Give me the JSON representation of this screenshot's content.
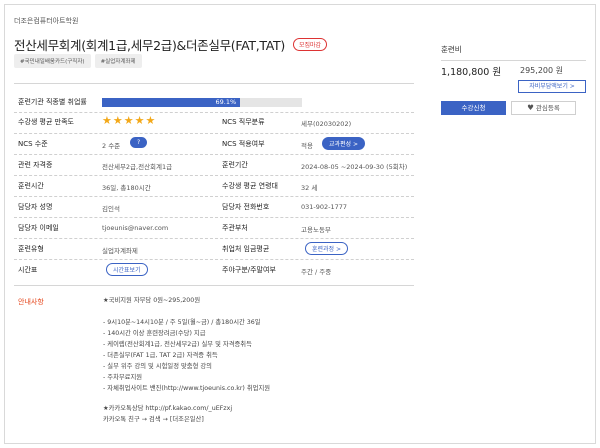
{
  "course": {
    "academy": "더조은컴퓨터아트학원",
    "title": "전산세무회계(회계1급,세무2급)&더존실무(FAT,TAT)",
    "badge": "모집마감",
    "tags": [
      "#국민내일배움카드(구직자)",
      "#실업자계좌제"
    ]
  },
  "info": {
    "employment_rate_label": "훈련기관 직종별 취업률",
    "employment_rate": 69.1,
    "employment_rate_text": "69.1%",
    "satisfaction_label": "수강생 평균 만족도",
    "satisfaction_stars": 5,
    "ncs_job_label": "NCS 직무분류",
    "ncs_job_value": "세무(02030202)",
    "ncs_level_label": "NCS 수준",
    "ncs_level_value": "2 수준",
    "ncs_apply_label": "NCS 적용여부",
    "ncs_apply_value": "적용",
    "curriculum_button": "교과편성 >",
    "cert_label": "관련 자격증",
    "cert_value": "전산세무2급,전산회계1급",
    "period_label": "훈련기간",
    "period_value": "2024-08-05 ~2024-09-30 (5회차)",
    "hours_label": "훈련시간",
    "hours_value": "36일, 총180시간",
    "age_label": "수강생 평균 연령대",
    "age_value": "32 세",
    "manager_label": "담당자 성명",
    "manager_value": "김인석",
    "phone_label": "담당자 전화번호",
    "phone_value": "031-902-1777",
    "email_label": "담당자 이메일",
    "email_value": "tjoeunis@naver.com",
    "dept_label": "주관부처",
    "dept_value": "고용노동부",
    "type_label": "훈련유형",
    "type_value": "실업자계좌제",
    "wage_label": "취업처 임금평균",
    "course_button": "훈련과정 >",
    "timetable_label": "시간표",
    "timetable_button": "시간표보기",
    "daytype_label": "주야구분/주말여부",
    "daytype_value": "주간 / 주중"
  },
  "notice": {
    "label": "안내사항",
    "lines": [
      "★국비지원 자부담 0원~295,200원",
      "",
      "- 9시10분~14시10분 / 주 5일(월~금) / 총180시간 36일",
      "- 140시간 이상 훈련장려금(수당) 지급",
      "- 케이렙(전산회계1급, 전산세무2급) 실무 및 자격증취득",
      "- 더존실무(FAT 1급, TAT 2급) 자격증 취득",
      "- 실무 위주 강의 및 시험일정 맞춤형 강의",
      "- 주차무료지원",
      "- 자체취업사이트 밴진(http://www.tjoeunis.co.kr) 취업지원",
      "",
      "★카카오톡상담 http://pf.kakao.com/_uEFzxj",
      "카카오톡 친구 → 검색 → [더조은일산]"
    ]
  },
  "panel": {
    "fee_label": "훈련비",
    "fee": "1,180,800 원",
    "self_pay": "295,200 원",
    "self_pay_button": "자비부담액보기 >",
    "apply_button": "수강신청",
    "fav_button": "관심등록"
  },
  "colors": {
    "accent": "#3b63c4",
    "notice": "#e5461c",
    "star": "#f3a818"
  }
}
